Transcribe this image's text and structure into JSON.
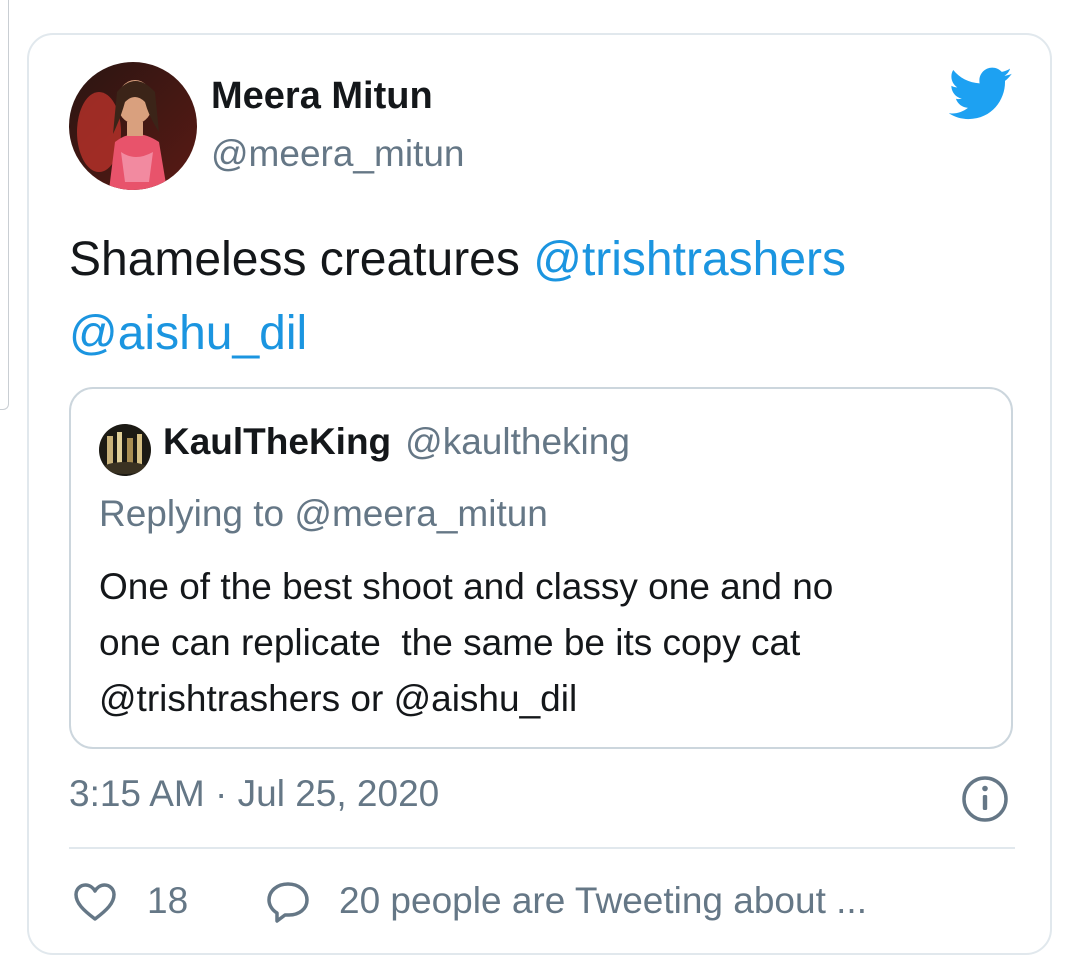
{
  "tweet": {
    "display_name": "Meera Mitun",
    "handle": "@meera_mitun",
    "text": "Shameless creatures",
    "mentions": [
      "@trishtrashers",
      "@aishu_dil"
    ],
    "timestamp": "3:15 AM · Jul 25, 2020",
    "like_count": "18",
    "tweeting_label": "20 people are Tweeting about ..."
  },
  "quoted_tweet": {
    "display_name": "KaulTheKing",
    "handle": "@kaultheking",
    "replying_to": "Replying to @meera_mitun",
    "text_lines": [
      "One of the best shoot and classy one and no",
      "one can replicate  the same be its copy cat",
      "@trishtrashers or @aishu_dil"
    ]
  },
  "icons": {
    "brand": "twitter-bird-icon",
    "info": "info-icon",
    "like": "heart-icon",
    "reply": "reply-bubble-icon"
  },
  "colors": {
    "mention": "#1b95e0",
    "brand": "#1da1f2",
    "secondary_text": "#657786",
    "border": "#e1e8ed"
  }
}
